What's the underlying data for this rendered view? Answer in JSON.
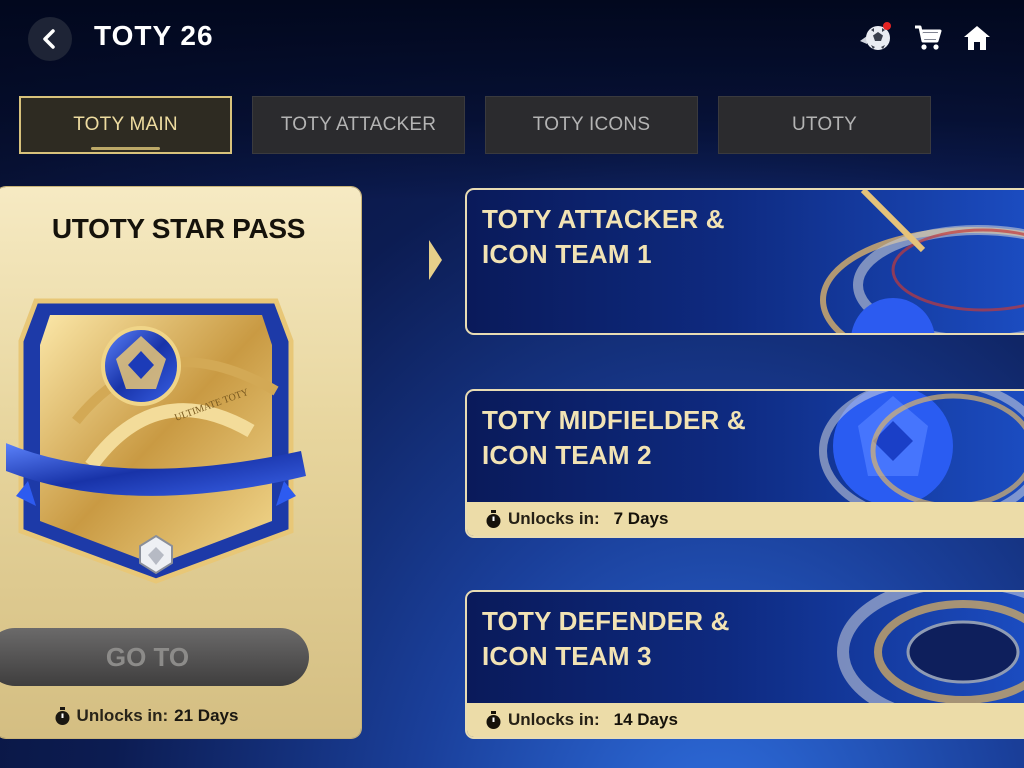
{
  "header": {
    "title": "TOTY 26"
  },
  "icons": {
    "back": "chevron-left-icon",
    "ball": "soccer-ball-icon",
    "cart": "cart-icon",
    "home": "home-icon"
  },
  "tabs": [
    {
      "label": "TOTY MAIN",
      "active": true
    },
    {
      "label": "TOTY ATTACKER",
      "active": false
    },
    {
      "label": "TOTY ICONS",
      "active": false
    },
    {
      "label": "UTOTY",
      "active": false
    }
  ],
  "star_pass": {
    "title": "UTOTY STAR PASS",
    "art_caption": "ULTIMATE TOTY",
    "button_label": "GO TO",
    "unlock_label": "Unlocks in:",
    "unlock_value": "21 Days"
  },
  "events": [
    {
      "title_line1": "TOTY ATTACKER &",
      "title_line2": "ICON TEAM 1"
    },
    {
      "title_line1": "TOTY MIDFIELDER &",
      "title_line2": "ICON TEAM 2",
      "unlock_label": "Unlocks in:",
      "unlock_value": "7 Days"
    },
    {
      "title_line1": "TOTY DEFENDER &",
      "title_line2": "ICON TEAM 3",
      "unlock_label": "Unlocks in:",
      "unlock_value": "14 Days"
    }
  ],
  "colors": {
    "gold": "#e8dcb4",
    "gold_text": "#f2e3b4",
    "navy": "#0a1a5a",
    "notification": "#e42424"
  }
}
